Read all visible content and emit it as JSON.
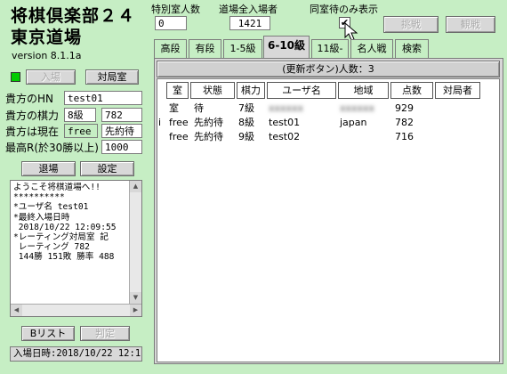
{
  "app": {
    "title_line1": "将棋倶楽部２４",
    "title_line2": "東京道場",
    "version": "version 8.1.1a"
  },
  "top": {
    "special_room_label": "特別室人数",
    "special_room_value": "0",
    "total_label": "道場全入場者",
    "total_value": "1421",
    "same_room_label": "同室待のみ表示",
    "same_room_checked": true,
    "challenge_button": "挑戦",
    "watch_button": "観戦"
  },
  "left": {
    "enter_button": "入場",
    "match_room_button": "対局室",
    "hn_label": "貴方のHN",
    "hn_value": "test01",
    "rating_label": "貴方の棋力",
    "rating_dan": "8級",
    "rating_value": "782",
    "status_label": "貴方は現在",
    "status_value": "free",
    "status_mode": "先約待",
    "max_rating_label": "最高R(於30勝以上)",
    "max_rating_value": "1000",
    "leave_button": "退場",
    "settings_button": "設定",
    "log_text": "ようこそ将棋道場へ!!\n**********\n*ユーザ名 test01\n*最終入場日時\n 2018/10/22 12:09:55\n*レーティング対局室 記\n レーティング 782\n 144勝 151敗 勝率 488",
    "blist_button": "Bリスト",
    "judge_button": "判定",
    "entry_time": "入場日時:2018/10/22 12:1"
  },
  "tabs": [
    {
      "label": "高段",
      "active": false
    },
    {
      "label": "有段",
      "active": false
    },
    {
      "label": "1-5級",
      "active": false
    },
    {
      "label": "6-10級",
      "active": true
    },
    {
      "label": "11級-",
      "active": false
    },
    {
      "label": "名人戦",
      "active": false
    },
    {
      "label": "検索",
      "active": false
    }
  ],
  "panel": {
    "refresh_header": "(更新ボタン)人数：3",
    "columns": [
      "室",
      "状態",
      "棋力",
      "ユーザ名",
      "地域",
      "点数",
      "対局者"
    ],
    "rows": [
      {
        "mark": "",
        "room": "室",
        "state": "待",
        "rank": "7級",
        "user": "xxxxxx",
        "region": "xxxxxx",
        "points": "929",
        "opponent": "",
        "blurred": true
      },
      {
        "mark": "i",
        "room": "free",
        "state": "先約待",
        "rank": "8級",
        "user": "test01",
        "region": "japan",
        "points": "782",
        "opponent": "",
        "blurred": false
      },
      {
        "mark": "",
        "room": "free",
        "state": "先約待",
        "rank": "9級",
        "user": "test02",
        "region": "",
        "points": "716",
        "opponent": "",
        "blurred": false
      }
    ]
  },
  "colors": {
    "background": "#c6eec4",
    "panel": "#d8d8d8",
    "status_free_bg": "#c6eec4",
    "indicator_green": "#00cc00"
  }
}
